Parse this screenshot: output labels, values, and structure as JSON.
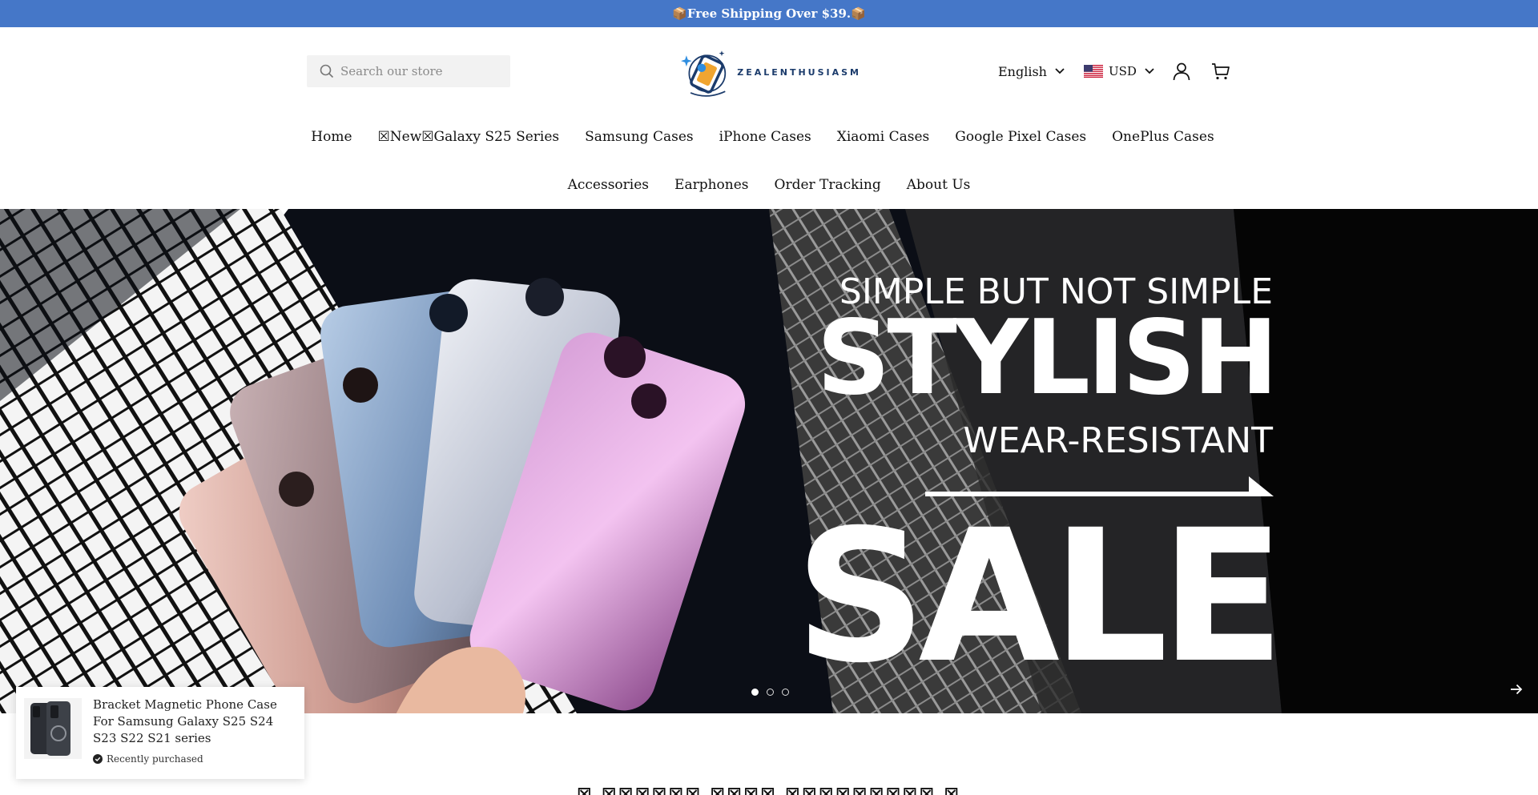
{
  "announcement": {
    "text": "📦Free Shipping Over $39.📦"
  },
  "search": {
    "placeholder": "Search our store",
    "icon": "search-icon"
  },
  "logo": {
    "text": "ZEALENTHUSIASM"
  },
  "header": {
    "language": "English",
    "currency": "USD",
    "currency_flag": "us-flag-icon",
    "account_icon": "user-icon",
    "cart_icon": "cart-icon"
  },
  "nav": {
    "row1": [
      {
        "label": "Home"
      },
      {
        "label": "☒New☒Galaxy S25 Series"
      },
      {
        "label": "Samsung Cases"
      },
      {
        "label": "iPhone Cases"
      },
      {
        "label": "Xiaomi Cases"
      },
      {
        "label": "Google Pixel Cases"
      },
      {
        "label": "OnePlus Cases"
      }
    ],
    "row2": [
      {
        "label": "Accessories"
      },
      {
        "label": "Earphones"
      },
      {
        "label": "Order Tracking"
      },
      {
        "label": "About Us"
      }
    ]
  },
  "hero": {
    "line1": "SIMPLE BUT NOT SIMPLE",
    "line2": "STYLISH",
    "line3": "WEAR-RESISTANT",
    "line4": "SALE",
    "slides_count": 3,
    "active_slide": 1
  },
  "popup": {
    "title": "Bracket Magnetic Phone Case For Samsung Galaxy S25 S24 S23 S22 S21 series",
    "status": "Recently purchased"
  },
  "section": {
    "heading": "☒ ☒☒☒☒☒☒ ☒☒☒☒ ☒☒☒☒☒☒☒☒☒ ☒"
  },
  "colors": {
    "announcement_bg": "#4577c8",
    "text": "#111111",
    "hero_bg": "#141414"
  }
}
